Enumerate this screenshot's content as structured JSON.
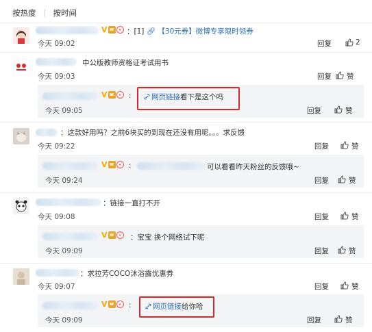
{
  "tabs": [
    "按热度",
    "按时间"
  ],
  "comments": [
    {
      "text_tail": "：[1]",
      "link_text": "【30元券】",
      "extra": "微博专享限时领券",
      "time": "今天 09:02",
      "reply": "回复",
      "likes": "2"
    },
    {
      "text": "中公版教师资格证考试用书",
      "time": "今天 09:03",
      "reply": "回复",
      "like_label": "赞",
      "sub": {
        "link_text": "网页链接",
        "text_after": "看下是这个吗",
        "time": "今天 09:05",
        "reply": "回复",
        "like_label": "赞"
      }
    },
    {
      "text": "：这款好用吗？之前6块买的到现在还没有用呢。。。求反馈",
      "time": "今天 09:22",
      "reply": "回复",
      "like_label": "赞",
      "sub": {
        "text_after": "可以看看昨天粉丝的反馈哦~",
        "time": "今天 09:24",
        "reply": "回复",
        "like_label": "赞"
      }
    },
    {
      "text": "：链接一直打不开",
      "time": "今天 09:08",
      "reply": "回复",
      "like_label": "赞",
      "sub": {
        "text_after": "：宝宝 换个网络试下呢",
        "time": "今天 09:09",
        "reply": "回复",
        "like_label": "赞"
      }
    },
    {
      "text": "：求拉芳COCO沐浴露优惠券",
      "time": "今天 09:07",
      "reply": "回复",
      "like_label": "赞",
      "sub": {
        "link_text": "网页链接",
        "text_after": "给你哈",
        "time": "今天 09:09",
        "reply": "回复",
        "like_label": "赞"
      }
    }
  ],
  "colors": {
    "link": "#2c6eb5",
    "highlight_box": "#d9262b",
    "vip": "#f7a800"
  },
  "icons": [
    "thumbs-up-icon",
    "link-clip-icon",
    "vip-v-icon",
    "weibo-member-icon",
    "pig-emoji-icon"
  ]
}
